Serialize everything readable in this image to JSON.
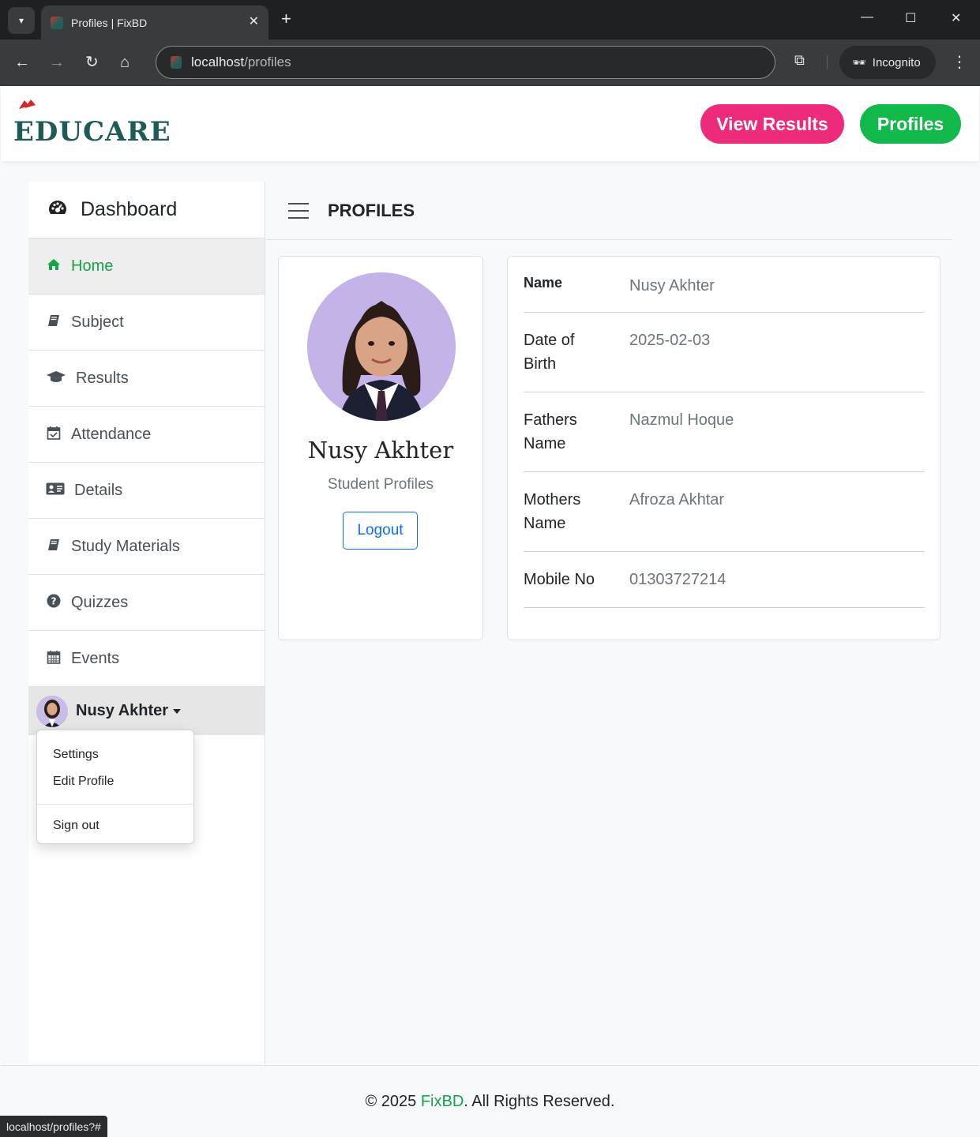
{
  "browser": {
    "tab_title": "Profiles | FixBD",
    "url_host": "localhost",
    "url_path": "/profiles",
    "incognito_label": "Incognito",
    "status_url": "localhost/profiles?#"
  },
  "header": {
    "logo_text": "EDUCARE",
    "view_results_label": "View Results",
    "profiles_label": "Profiles",
    "colors": {
      "view_results": "#ee2a7b",
      "profiles": "#10b94a"
    }
  },
  "sidebar": {
    "title": "Dashboard",
    "items": [
      {
        "label": "Home",
        "icon": "home-icon",
        "active": true
      },
      {
        "label": "Subject",
        "icon": "book-icon"
      },
      {
        "label": "Results",
        "icon": "graduation-cap-icon"
      },
      {
        "label": "Attendance",
        "icon": "calendar-check-icon"
      },
      {
        "label": "Details",
        "icon": "id-card-icon"
      },
      {
        "label": "Study Materials",
        "icon": "book-icon"
      },
      {
        "label": "Quizzes",
        "icon": "question-circle-icon"
      },
      {
        "label": "Events",
        "icon": "calendar-icon"
      }
    ],
    "user_name": "Nusy Akhter",
    "dropdown": [
      "Settings",
      "Edit Profile",
      "Sign out"
    ]
  },
  "main": {
    "title": "PROFILES",
    "profile": {
      "name": "Nusy Akhter",
      "subtitle": "Student Profiles",
      "logout_label": "Logout"
    },
    "details": [
      {
        "label": "Name",
        "value": "Nusy Akhter"
      },
      {
        "label": "Date of Birth",
        "value": "2025-02-03"
      },
      {
        "label": "Fathers Name",
        "value": "Nazmul Hoque"
      },
      {
        "label": "Mothers Name",
        "value": "Afroza Akhtar"
      },
      {
        "label": "Mobile No",
        "value": "01303727214"
      }
    ]
  },
  "footer": {
    "prefix": "© 2025 ",
    "brand": "FixBD",
    "suffix": ". All Rights Reserved."
  }
}
